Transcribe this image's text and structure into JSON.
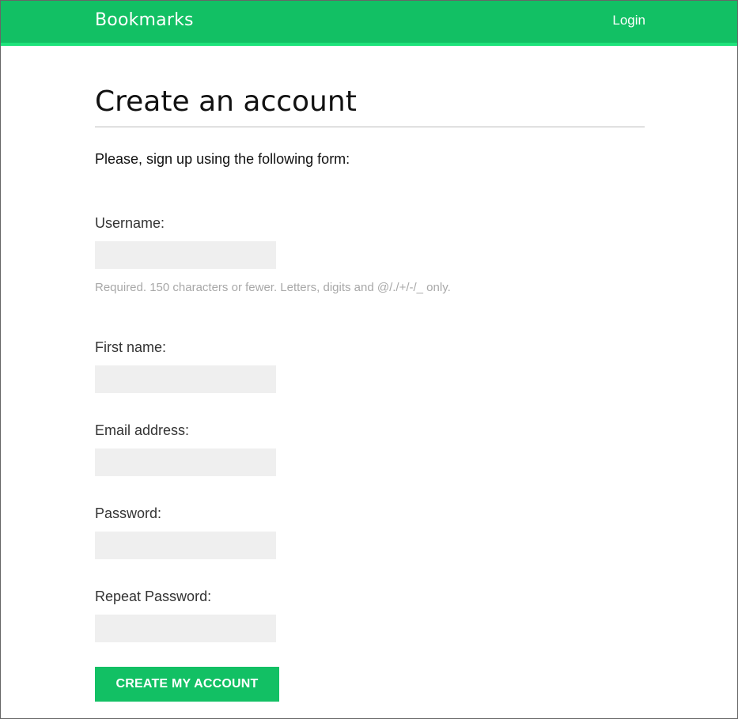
{
  "header": {
    "brand": "Bookmarks",
    "login_label": "Login"
  },
  "page": {
    "title": "Create an account",
    "intro": "Please, sign up using the following form:"
  },
  "form": {
    "fields": [
      {
        "label": "Username:",
        "value": "",
        "help": "Required. 150 characters or fewer. Letters, digits and @/./+/-/_ only."
      },
      {
        "label": "First name:",
        "value": ""
      },
      {
        "label": "Email address:",
        "value": ""
      },
      {
        "label": "Password:",
        "value": ""
      },
      {
        "label": "Repeat Password:",
        "value": ""
      }
    ],
    "submit_label": "CREATE MY ACCOUNT"
  },
  "colors": {
    "accent": "#12c064",
    "accent_light": "#1ee37b",
    "input_bg": "#efefef",
    "help_text": "#a8a8a8"
  }
}
